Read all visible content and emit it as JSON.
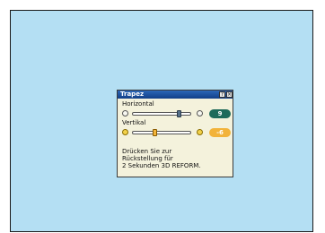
{
  "dialog": {
    "title": "Trapez",
    "help_label": "?",
    "close_label": "×"
  },
  "horizontal": {
    "label": "Horizontal",
    "value": "9",
    "level": 0.79
  },
  "vertical": {
    "label": "Vertikal",
    "value": "-6",
    "level": 0.38
  },
  "message": {
    "line1": "Drücken Sie zur",
    "line2": "Rückstellung für",
    "line3": "2 Sekunden 3D REFORM."
  },
  "colors": {
    "screen_bg": "#b4dff3",
    "dialog_bg": "#f4f2dc",
    "titlebar": "#1f54a0",
    "horizontal_value_bg": "#1e6a5a",
    "vertical_value_bg": "#f2b33a"
  }
}
